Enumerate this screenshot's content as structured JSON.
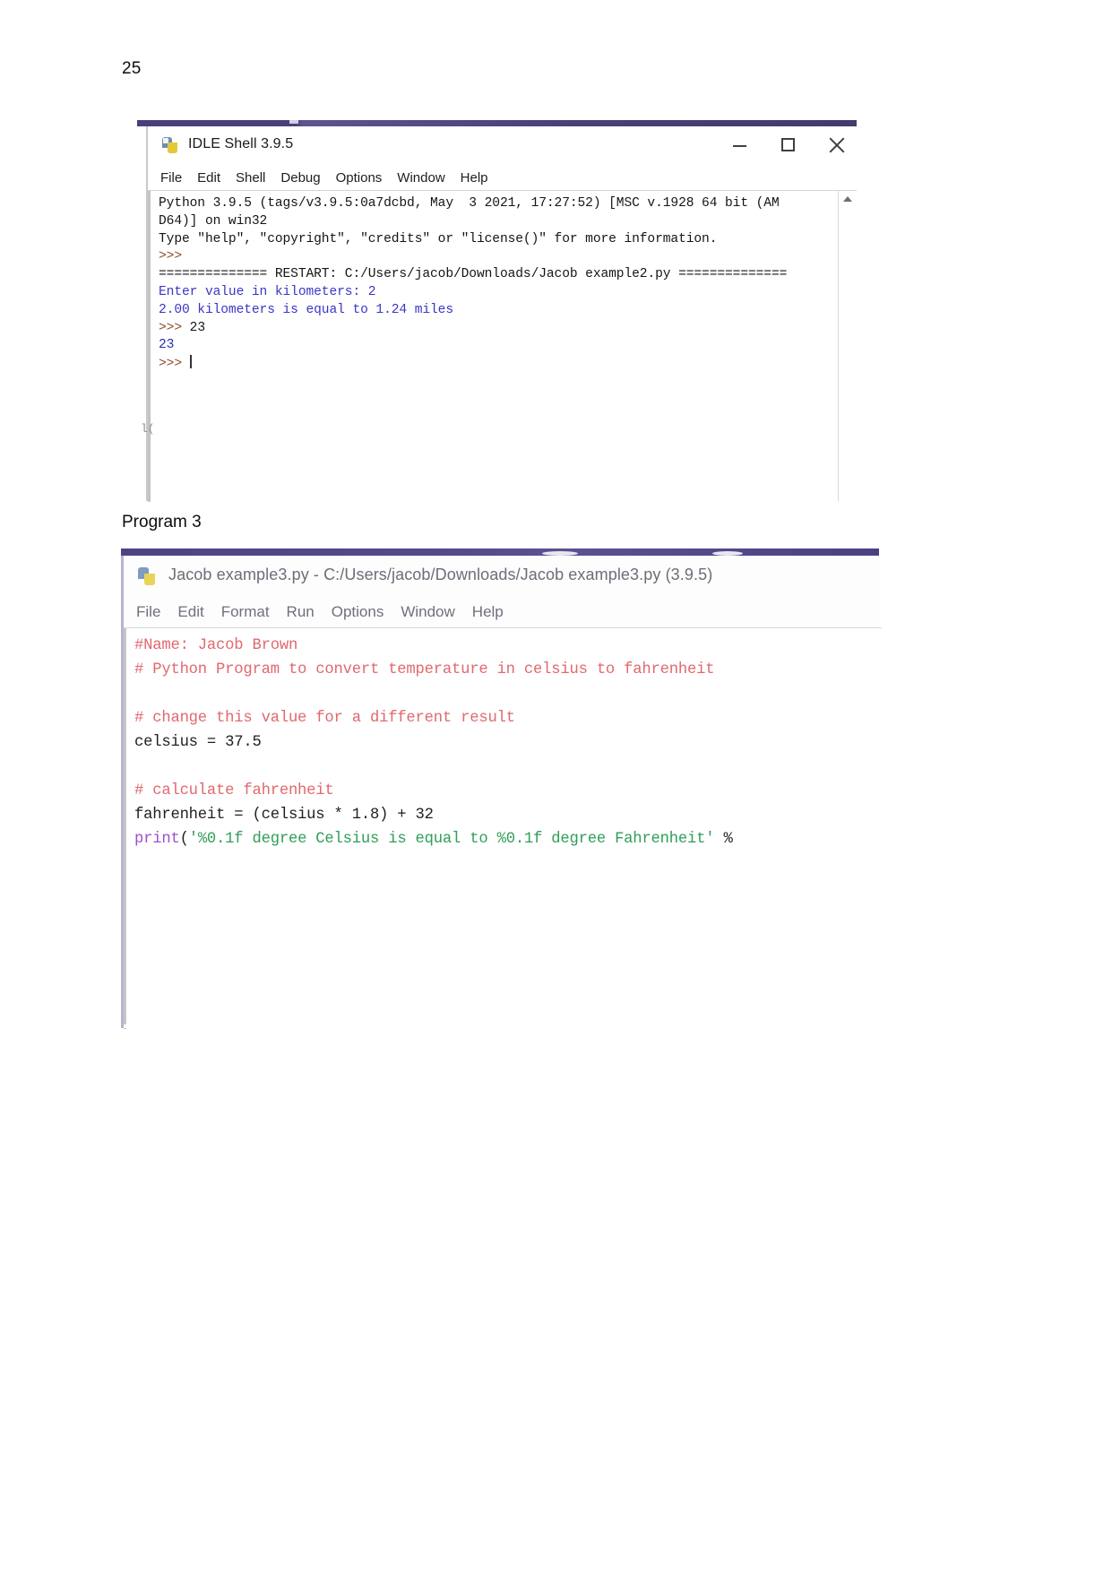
{
  "document": {
    "page_number": "25",
    "caption_program3": "Program 3"
  },
  "shell_window": {
    "title": "IDLE Shell 3.9.5",
    "icon": "python-file-icon",
    "window_controls": {
      "minimize": "–",
      "maximize": "□",
      "close": "✕"
    },
    "menu": [
      "File",
      "Edit",
      "Shell",
      "Debug",
      "Options",
      "Window",
      "Help"
    ],
    "console_lines": [
      {
        "text": "Python 3.9.5 (tags/v3.9.5:0a7dcbd, May  3 2021, 17:27:52) [MSC v.1928 64 bit (AM",
        "color": "black"
      },
      {
        "text": "D64)] on win32",
        "color": "black"
      },
      {
        "text": "Type \"help\", \"copyright\", \"credits\" or \"license()\" for more information.",
        "color": "black"
      },
      {
        "text": ">>>",
        "color": "brown"
      },
      {
        "text": "============== RESTART: C:/Users/jacob/Downloads/Jacob example2.py ==============",
        "color": "black"
      },
      {
        "text": "Enter value in kilometers: 2",
        "color": "blue"
      },
      {
        "text": "2.00 kilometers is equal to 1.24 miles",
        "color": "blue"
      },
      {
        "text": ">>> 23",
        "color": "prompt-with-input"
      },
      {
        "text": "23",
        "color": "navy"
      },
      {
        "text": ">>> ",
        "color": "prompt-cursor"
      }
    ],
    "prompt_symbol": ">>>",
    "last_input": "23",
    "last_output": "23",
    "edge_artifact": "l(",
    "scrollbar": "vertical-scrollbar"
  },
  "editor_window": {
    "title": "Jacob example3.py - C:/Users/jacob/Downloads/Jacob example3.py (3.9.5)",
    "icon": "python-file-icon",
    "menu": [
      "File",
      "Edit",
      "Format",
      "Run",
      "Options",
      "Window",
      "Help"
    ],
    "code_lines": [
      {
        "type": "comment",
        "text": "#Name: Jacob Brown"
      },
      {
        "type": "comment",
        "text": "# Python Program to convert temperature in celsius to fahrenheit"
      },
      {
        "type": "blank",
        "text": ""
      },
      {
        "type": "comment",
        "text": "# change this value for a different result"
      },
      {
        "type": "code",
        "text": "celsius = 37.5"
      },
      {
        "type": "blank",
        "text": ""
      },
      {
        "type": "comment",
        "text": "# calculate fahrenheit"
      },
      {
        "type": "code",
        "text": "fahrenheit = (celsius * 1.8) + 32"
      },
      {
        "type": "print",
        "func": "print",
        "open": "(",
        "string": "'%0.1f degree Celsius is equal to %0.1f degree Fahrenheit'",
        "tail": " %"
      }
    ]
  },
  "colors": {
    "titlebar_accent": "#4b3f7a",
    "comment_red": "#e0696e",
    "string_green": "#2f9e58",
    "builtin_purple": "#9e4fd0",
    "shell_blue": "#3a36c8",
    "shell_brown": "#8a4b2a",
    "shell_navy": "#2b2bb5"
  }
}
